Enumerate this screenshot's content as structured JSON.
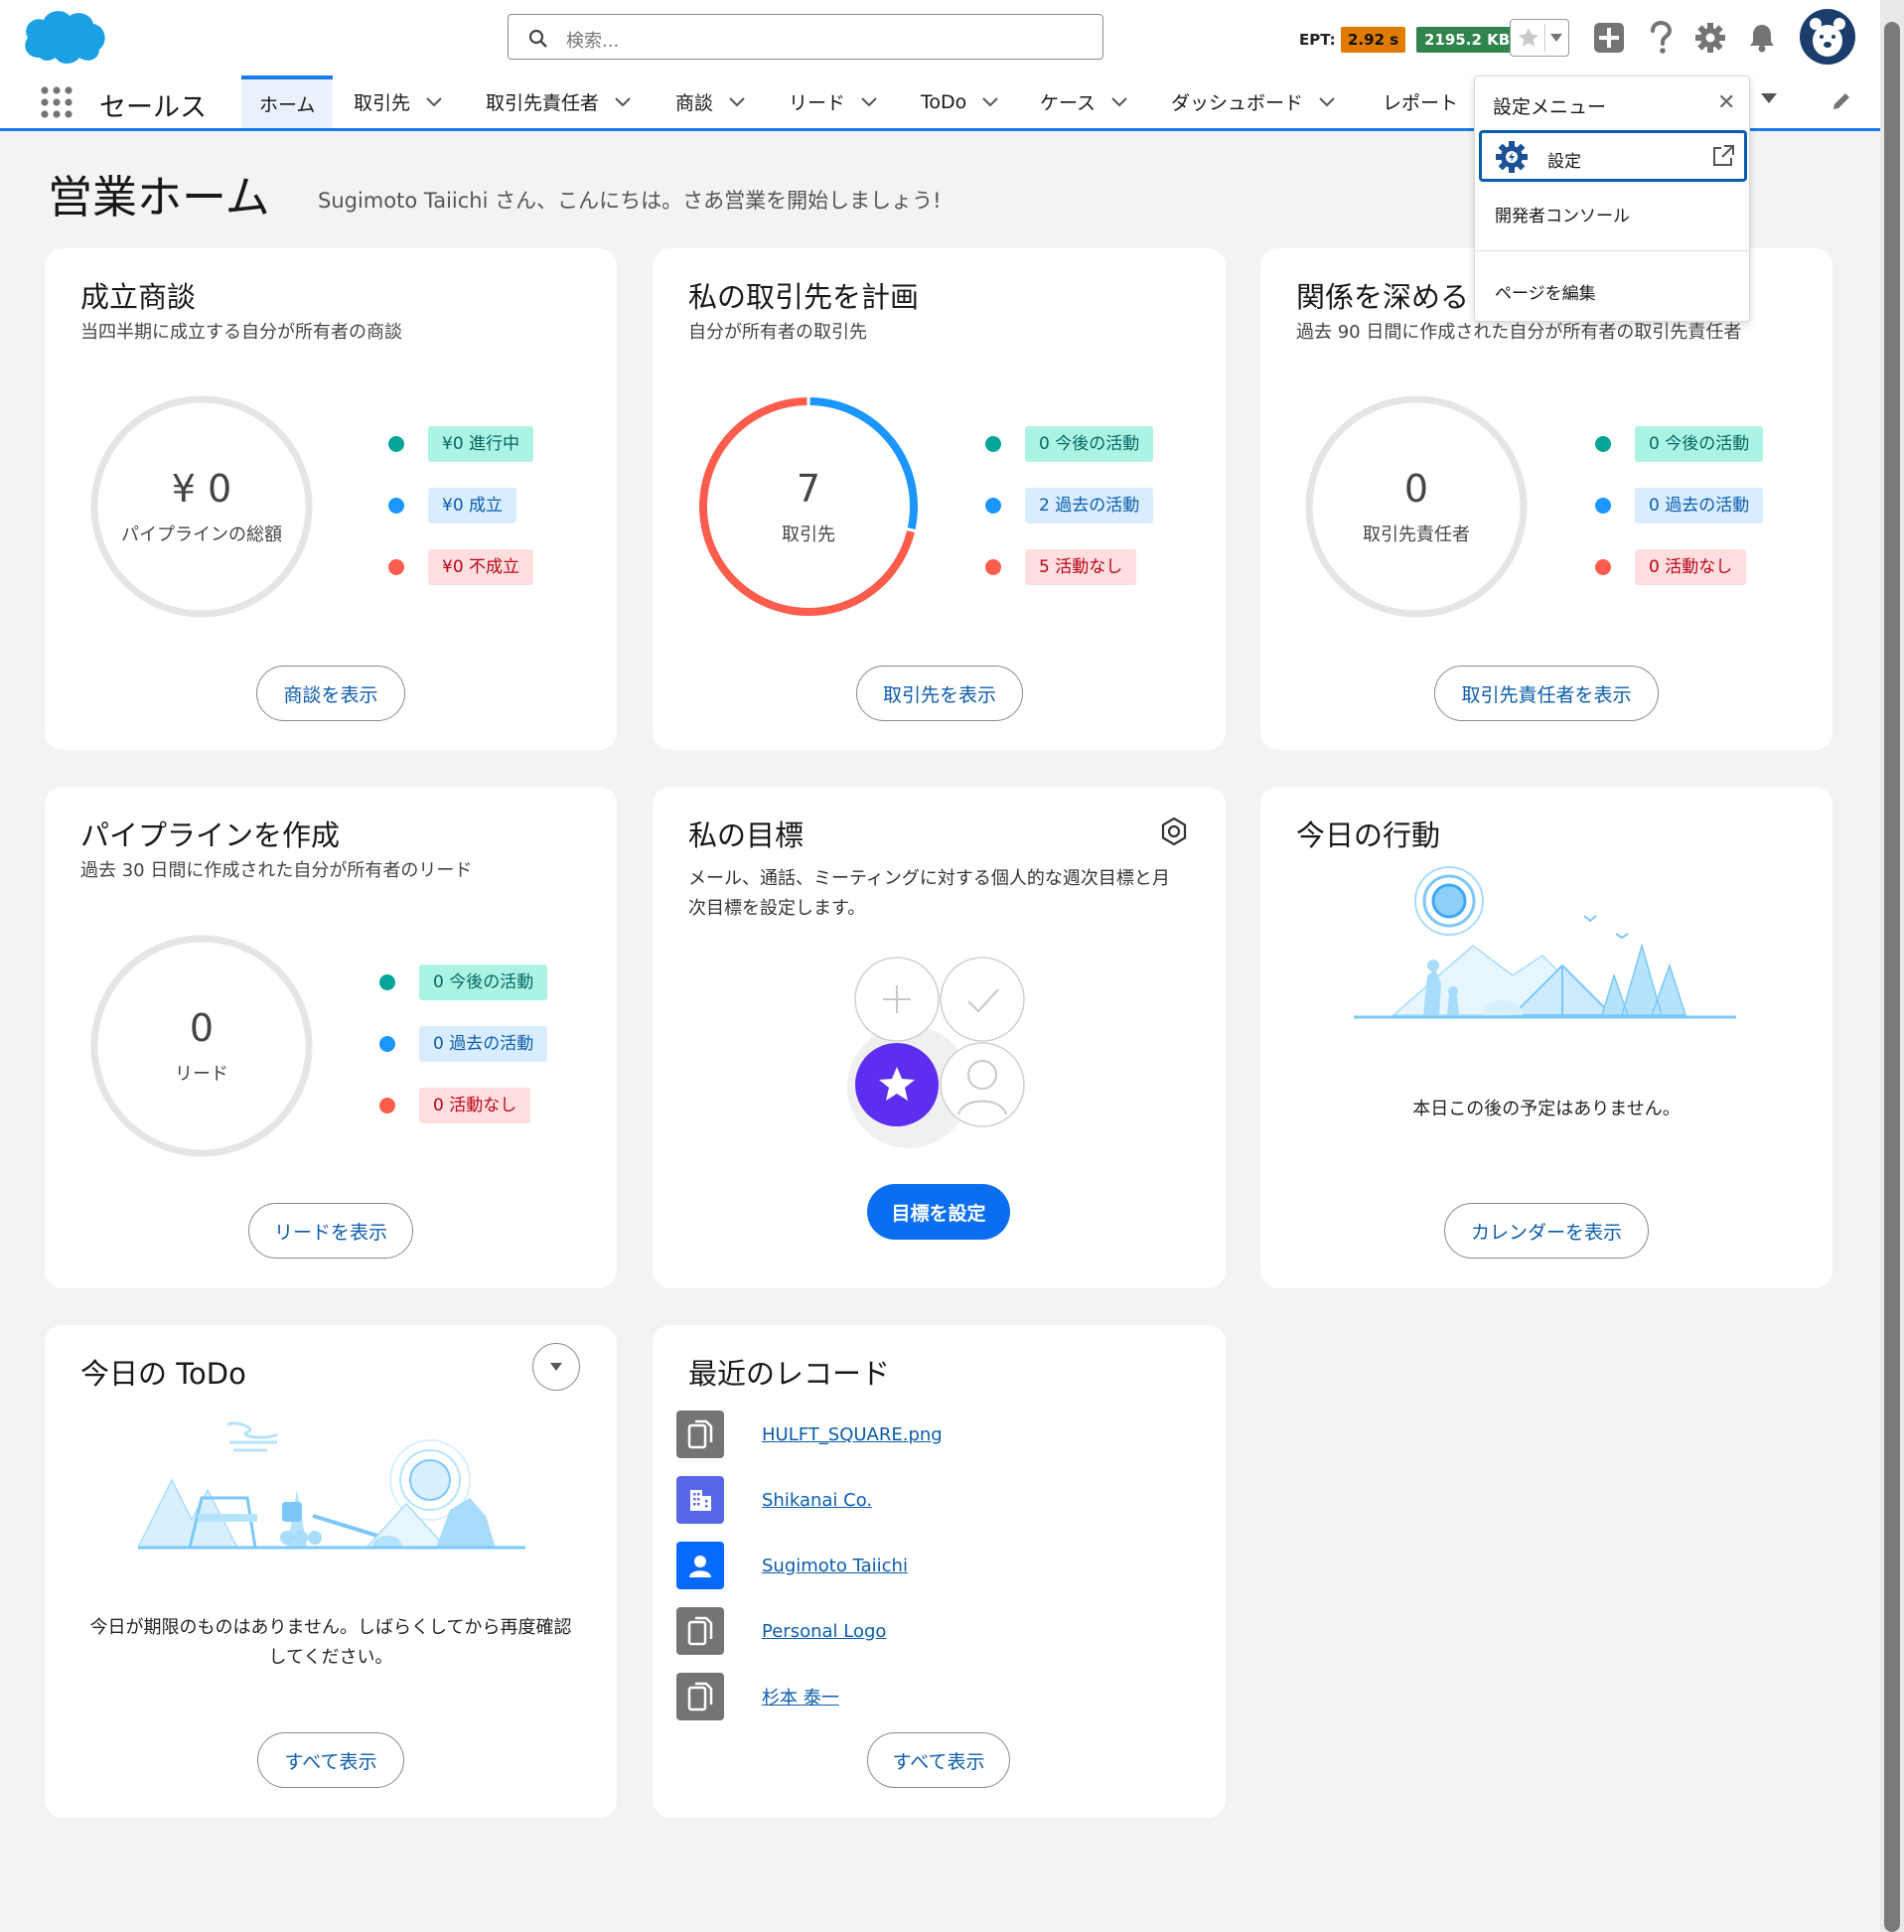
{
  "header": {
    "search_placeholder": "検索...",
    "ept_label": "EPT:",
    "ept_value": "2.92 s",
    "kb_value": "2195.2 KB"
  },
  "nav": {
    "app_name": "セールス",
    "tabs": [
      {
        "label": "ホーム"
      },
      {
        "label": "取引先"
      },
      {
        "label": "取引先責任者"
      },
      {
        "label": "商談"
      },
      {
        "label": "リード"
      },
      {
        "label": "ToDo"
      },
      {
        "label": "ケース"
      },
      {
        "label": "ダッシュボード"
      },
      {
        "label": "レポート"
      }
    ]
  },
  "setup_menu": {
    "title": "設定メニュー",
    "items": [
      {
        "label": "設定"
      },
      {
        "label": "開発者コンソール"
      },
      {
        "label": "ページを編集"
      }
    ]
  },
  "page": {
    "title": "営業ホーム",
    "subtitle": "Sugimoto Taiichi さん、こんにちは。さあ営業を開始しましょう!"
  },
  "cards": {
    "deals": {
      "title": "成立商談",
      "subtitle": "当四半期に成立する自分が所有者の商談",
      "ring_value": "¥ 0",
      "ring_label": "パイプラインの総額",
      "legend": [
        "¥0 進行中",
        "¥0 成立",
        "¥0 不成立"
      ],
      "button": "商談を表示"
    },
    "accounts": {
      "title": "私の取引先を計画",
      "subtitle": "自分が所有者の取引先",
      "ring_value": "7",
      "ring_label": "取引先",
      "legend": [
        "0 今後の活動",
        "2 過去の活動",
        "5 活動なし"
      ],
      "button": "取引先を表示"
    },
    "contacts": {
      "title": "関係を深める",
      "subtitle": "過去 90 日間に作成された自分が所有者の取引先責任者",
      "ring_value": "0",
      "ring_label": "取引先責任者",
      "legend": [
        "0 今後の活動",
        "0 過去の活動",
        "0 活動なし"
      ],
      "button": "取引先責任者を表示"
    },
    "pipeline": {
      "title": "パイプラインを作成",
      "subtitle": "過去 30 日間に作成された自分が所有者のリード",
      "ring_value": "0",
      "ring_label": "リード",
      "legend": [
        "0 今後の活動",
        "0 過去の活動",
        "0 活動なし"
      ],
      "button": "リードを表示"
    },
    "goals": {
      "title": "私の目標",
      "description": "メール、通話、ミーティングに対する個人的な週次目標と月次目標を設定します。",
      "button": "目標を設定"
    },
    "today_events": {
      "title": "今日の行動",
      "empty_text": "本日この後の予定はありません。",
      "button": "カレンダーを表示"
    },
    "today_todo": {
      "title": "今日の ToDo",
      "empty_text_line1": "今日が期限のものはありません。しばらくしてから再度確認",
      "empty_text_line2": "してください。",
      "button": "すべて表示"
    },
    "recent_records": {
      "title": "最近のレコード",
      "items": [
        {
          "name": "HULFT_SQUARE.png",
          "icon": "file-icon"
        },
        {
          "name": "Shikanai Co.",
          "icon": "account-icon"
        },
        {
          "name": "Sugimoto Taiichi",
          "icon": "user-icon"
        },
        {
          "name": "Personal Logo",
          "icon": "file-icon"
        },
        {
          "name": "杉本 泰一",
          "icon": "file-icon"
        }
      ],
      "button": "すべて表示"
    }
  },
  "colors": {
    "brand": "#0b6ef0",
    "accent_blue": "#1b96ff",
    "ring_red": "#fe5c4c",
    "ept_orange": "#e07b00",
    "kb_green": "#2e844a"
  },
  "accounts_ring_chart": {
    "total": 7,
    "segments": [
      {
        "value": 2,
        "color": "#1b96ff"
      },
      {
        "value": 5,
        "color": "#fe5c4c"
      }
    ]
  }
}
